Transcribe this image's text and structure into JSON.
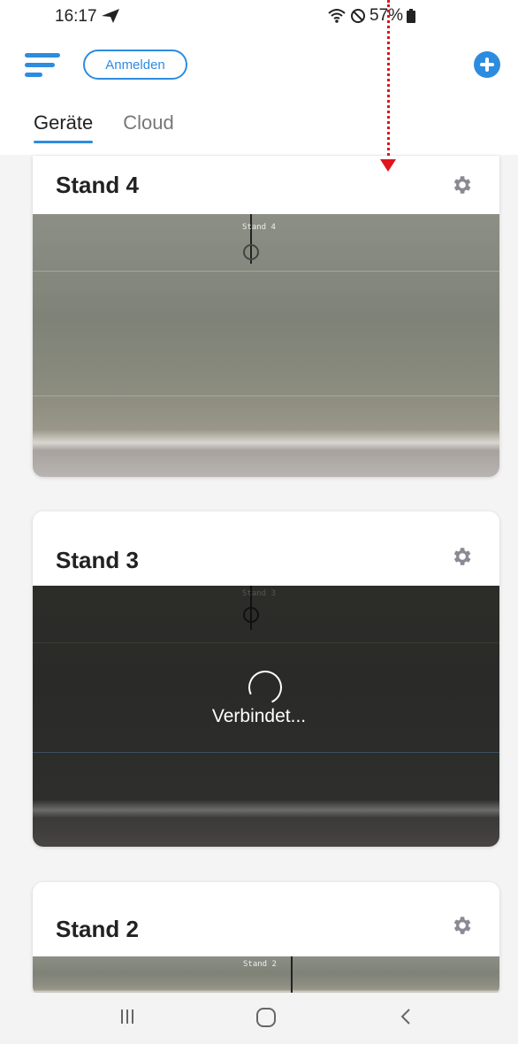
{
  "status": {
    "time": "16:17",
    "battery": "57%"
  },
  "header": {
    "login_label": "Anmelden"
  },
  "tabs": [
    {
      "label": "Geräte",
      "active": true
    },
    {
      "label": "Cloud",
      "active": false
    }
  ],
  "devices": [
    {
      "name": "Stand 4",
      "overlay": "Stand 4",
      "state": "live"
    },
    {
      "name": "Stand 3",
      "overlay": "Stand 3",
      "state": "connecting",
      "state_text": "Verbindet..."
    },
    {
      "name": "Stand 2",
      "overlay": "Stand 2",
      "state": "live"
    }
  ],
  "icons": {
    "menu": "menu-icon",
    "add": "plus-circle-icon",
    "gear": "gear-icon",
    "nav_recent": "recent-apps-icon",
    "nav_home": "home-icon",
    "nav_back": "back-icon"
  },
  "colors": {
    "accent": "#2d8cdf",
    "annotation": "#e0141a"
  }
}
